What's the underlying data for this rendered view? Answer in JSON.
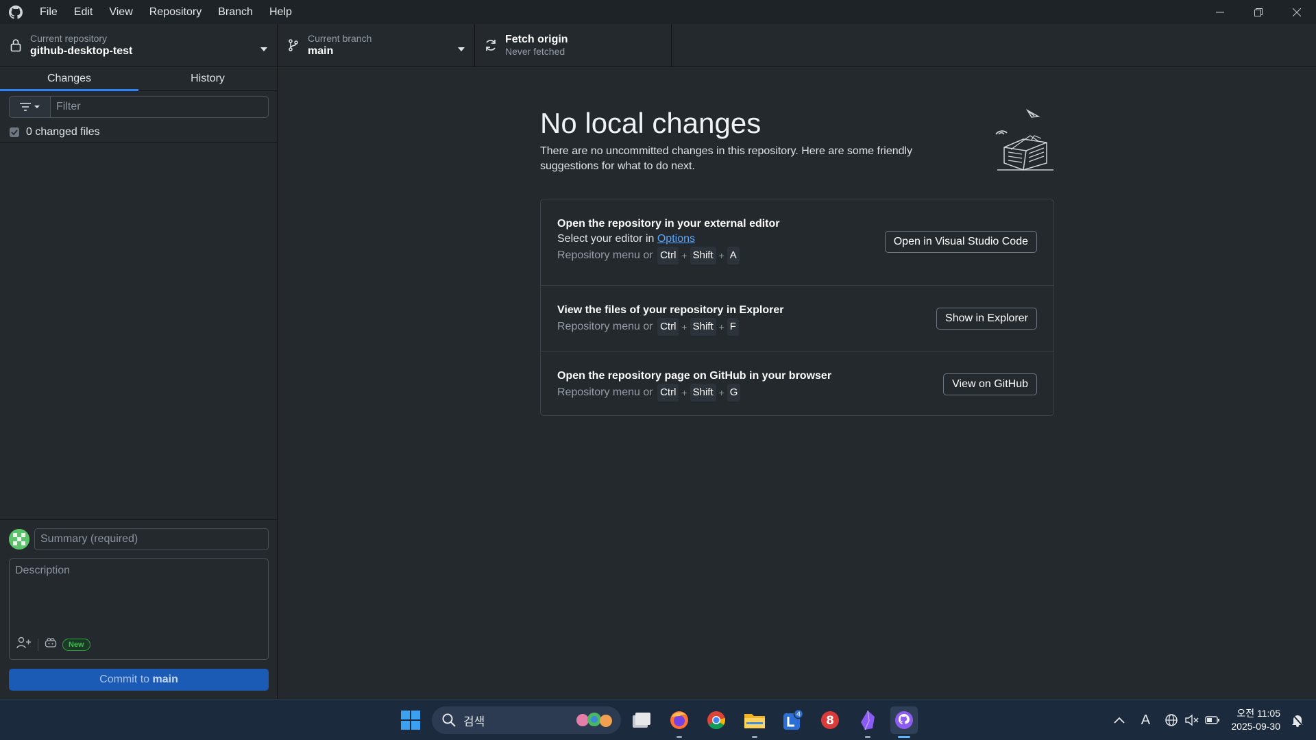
{
  "titlebar": {
    "menu": [
      "File",
      "Edit",
      "View",
      "Repository",
      "Branch",
      "Help"
    ]
  },
  "toolbar": {
    "repo_label": "Current repository",
    "repo_value": "github-desktop-test",
    "branch_label": "Current branch",
    "branch_value": "main",
    "fetch_label": "Fetch origin",
    "fetch_value": "Never fetched"
  },
  "sidebar": {
    "tabs": [
      "Changes",
      "History"
    ],
    "active_tab": "Changes",
    "filter_placeholder": "Filter",
    "changed_files": "0 changed files",
    "summary_placeholder": "Summary (required)",
    "description_placeholder": "Description",
    "new_badge": "New",
    "commit_prefix": "Commit to",
    "commit_branch": "main"
  },
  "main": {
    "title": "No local changes",
    "description": "There are no uncommitted changes in this repository. Here are some friendly suggestions for what to do next.",
    "suggestions": [
      {
        "title": "Open the repository in your external editor",
        "line_prefix": "Select your editor in",
        "line_link": "Options",
        "shortcut_prefix": "Repository menu or",
        "keys": [
          "Ctrl",
          "Shift",
          "A"
        ],
        "button": "Open in Visual Studio Code"
      },
      {
        "title": "View the files of your repository in Explorer",
        "shortcut_prefix": "Repository menu or",
        "keys": [
          "Ctrl",
          "Shift",
          "F"
        ],
        "button": "Show in Explorer"
      },
      {
        "title": "Open the repository page on GitHub in your browser",
        "shortcut_prefix": "Repository menu or",
        "keys": [
          "Ctrl",
          "Shift",
          "G"
        ],
        "button": "View on GitHub"
      }
    ]
  },
  "taskbar": {
    "search_text": "검색",
    "badge_count": "4",
    "clock_time": "오전 11:05",
    "clock_date": "2025-09-30",
    "ime": "A"
  },
  "colors": {
    "accent": "#2f81f7",
    "commit_button": "#1c5bb5",
    "background": "#24292e",
    "link": "#58a6ff"
  }
}
